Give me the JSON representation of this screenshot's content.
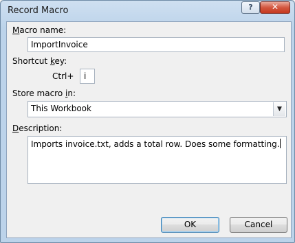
{
  "window": {
    "title": "Record Macro",
    "help_label": "?",
    "close_label": "✕"
  },
  "macro_name": {
    "label_pre": "",
    "label_accel": "M",
    "label_post": "acro name:",
    "value": "ImportInvoice"
  },
  "shortcut": {
    "label_pre": "Shortcut ",
    "label_accel": "k",
    "label_post": "ey:",
    "prefix": "Ctrl+",
    "value": "i"
  },
  "store": {
    "label_pre": "Store macro ",
    "label_accel": "i",
    "label_post": "n:",
    "selected": "This Workbook",
    "dropdown_icon": "chevron-down-icon"
  },
  "description": {
    "label_pre": "",
    "label_accel": "D",
    "label_post": "escription:",
    "value": "Imports invoice.txt, adds a total row. Does some formatting."
  },
  "buttons": {
    "ok": "OK",
    "cancel": "Cancel"
  }
}
